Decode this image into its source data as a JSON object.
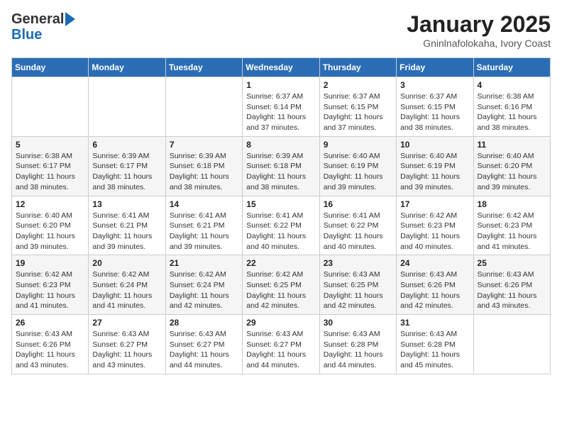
{
  "logo": {
    "general": "General",
    "blue": "Blue"
  },
  "title": "January 2025",
  "location": "Gninlnafolokaha, Ivory Coast",
  "days_of_week": [
    "Sunday",
    "Monday",
    "Tuesday",
    "Wednesday",
    "Thursday",
    "Friday",
    "Saturday"
  ],
  "weeks": [
    [
      {
        "day": "",
        "info": ""
      },
      {
        "day": "",
        "info": ""
      },
      {
        "day": "",
        "info": ""
      },
      {
        "day": "1",
        "info": "Sunrise: 6:37 AM\nSunset: 6:14 PM\nDaylight: 11 hours and 37 minutes."
      },
      {
        "day": "2",
        "info": "Sunrise: 6:37 AM\nSunset: 6:15 PM\nDaylight: 11 hours and 37 minutes."
      },
      {
        "day": "3",
        "info": "Sunrise: 6:37 AM\nSunset: 6:15 PM\nDaylight: 11 hours and 38 minutes."
      },
      {
        "day": "4",
        "info": "Sunrise: 6:38 AM\nSunset: 6:16 PM\nDaylight: 11 hours and 38 minutes."
      }
    ],
    [
      {
        "day": "5",
        "info": "Sunrise: 6:38 AM\nSunset: 6:17 PM\nDaylight: 11 hours and 38 minutes."
      },
      {
        "day": "6",
        "info": "Sunrise: 6:39 AM\nSunset: 6:17 PM\nDaylight: 11 hours and 38 minutes."
      },
      {
        "day": "7",
        "info": "Sunrise: 6:39 AM\nSunset: 6:18 PM\nDaylight: 11 hours and 38 minutes."
      },
      {
        "day": "8",
        "info": "Sunrise: 6:39 AM\nSunset: 6:18 PM\nDaylight: 11 hours and 38 minutes."
      },
      {
        "day": "9",
        "info": "Sunrise: 6:40 AM\nSunset: 6:19 PM\nDaylight: 11 hours and 39 minutes."
      },
      {
        "day": "10",
        "info": "Sunrise: 6:40 AM\nSunset: 6:19 PM\nDaylight: 11 hours and 39 minutes."
      },
      {
        "day": "11",
        "info": "Sunrise: 6:40 AM\nSunset: 6:20 PM\nDaylight: 11 hours and 39 minutes."
      }
    ],
    [
      {
        "day": "12",
        "info": "Sunrise: 6:40 AM\nSunset: 6:20 PM\nDaylight: 11 hours and 39 minutes."
      },
      {
        "day": "13",
        "info": "Sunrise: 6:41 AM\nSunset: 6:21 PM\nDaylight: 11 hours and 39 minutes."
      },
      {
        "day": "14",
        "info": "Sunrise: 6:41 AM\nSunset: 6:21 PM\nDaylight: 11 hours and 39 minutes."
      },
      {
        "day": "15",
        "info": "Sunrise: 6:41 AM\nSunset: 6:22 PM\nDaylight: 11 hours and 40 minutes."
      },
      {
        "day": "16",
        "info": "Sunrise: 6:41 AM\nSunset: 6:22 PM\nDaylight: 11 hours and 40 minutes."
      },
      {
        "day": "17",
        "info": "Sunrise: 6:42 AM\nSunset: 6:23 PM\nDaylight: 11 hours and 40 minutes."
      },
      {
        "day": "18",
        "info": "Sunrise: 6:42 AM\nSunset: 6:23 PM\nDaylight: 11 hours and 41 minutes."
      }
    ],
    [
      {
        "day": "19",
        "info": "Sunrise: 6:42 AM\nSunset: 6:23 PM\nDaylight: 11 hours and 41 minutes."
      },
      {
        "day": "20",
        "info": "Sunrise: 6:42 AM\nSunset: 6:24 PM\nDaylight: 11 hours and 41 minutes."
      },
      {
        "day": "21",
        "info": "Sunrise: 6:42 AM\nSunset: 6:24 PM\nDaylight: 11 hours and 42 minutes."
      },
      {
        "day": "22",
        "info": "Sunrise: 6:42 AM\nSunset: 6:25 PM\nDaylight: 11 hours and 42 minutes."
      },
      {
        "day": "23",
        "info": "Sunrise: 6:43 AM\nSunset: 6:25 PM\nDaylight: 11 hours and 42 minutes."
      },
      {
        "day": "24",
        "info": "Sunrise: 6:43 AM\nSunset: 6:26 PM\nDaylight: 11 hours and 42 minutes."
      },
      {
        "day": "25",
        "info": "Sunrise: 6:43 AM\nSunset: 6:26 PM\nDaylight: 11 hours and 43 minutes."
      }
    ],
    [
      {
        "day": "26",
        "info": "Sunrise: 6:43 AM\nSunset: 6:26 PM\nDaylight: 11 hours and 43 minutes."
      },
      {
        "day": "27",
        "info": "Sunrise: 6:43 AM\nSunset: 6:27 PM\nDaylight: 11 hours and 43 minutes."
      },
      {
        "day": "28",
        "info": "Sunrise: 6:43 AM\nSunset: 6:27 PM\nDaylight: 11 hours and 44 minutes."
      },
      {
        "day": "29",
        "info": "Sunrise: 6:43 AM\nSunset: 6:27 PM\nDaylight: 11 hours and 44 minutes."
      },
      {
        "day": "30",
        "info": "Sunrise: 6:43 AM\nSunset: 6:28 PM\nDaylight: 11 hours and 44 minutes."
      },
      {
        "day": "31",
        "info": "Sunrise: 6:43 AM\nSunset: 6:28 PM\nDaylight: 11 hours and 45 minutes."
      },
      {
        "day": "",
        "info": ""
      }
    ]
  ]
}
